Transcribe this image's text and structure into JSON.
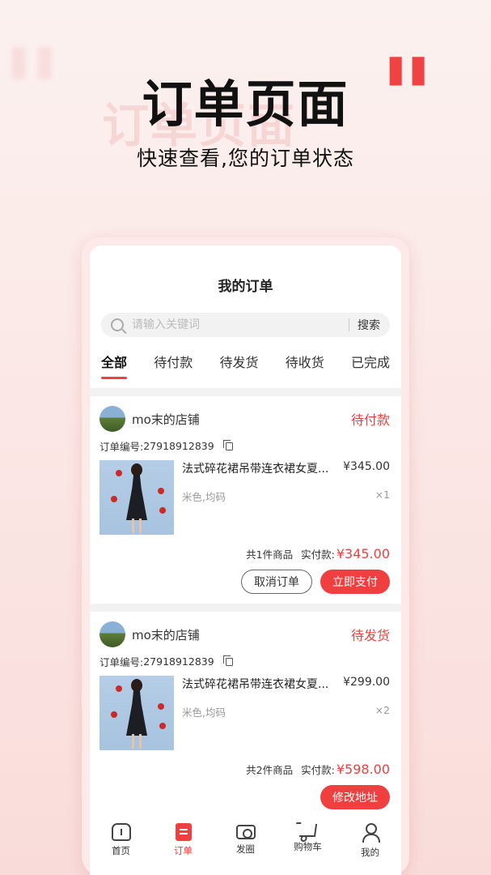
{
  "promo": {
    "title": "订单页面",
    "subtitle": "快速查看,您的订单状态"
  },
  "page": {
    "title": "我的订单"
  },
  "search": {
    "placeholder": "请输入关键词",
    "button": "搜索"
  },
  "tabs": [
    {
      "label": "全部",
      "active": true
    },
    {
      "label": "待付款",
      "active": false
    },
    {
      "label": "待发货",
      "active": false
    },
    {
      "label": "待收货",
      "active": false
    },
    {
      "label": "已完成",
      "active": false
    }
  ],
  "orders": [
    {
      "shop_name": "mo末的店铺",
      "status": "待付款",
      "order_no_label": "订单编号:",
      "order_no": "27918912839",
      "product_name": "法式碎花裙吊带连衣裙女夏...",
      "price": "¥345.00",
      "spec": "米色,均码",
      "qty": "×1",
      "count_text": "共1件商品",
      "paid_label": "实付款:",
      "paid_amount": "¥345.00",
      "buttons": [
        "取消订单",
        "立即支付"
      ]
    },
    {
      "shop_name": "mo末的店铺",
      "status": "待发货",
      "order_no_label": "订单编号:",
      "order_no": "27918912839",
      "product_name": "法式碎花裙吊带连衣裙女夏...",
      "price": "¥299.00",
      "spec": "米色,均码",
      "qty": "×2",
      "count_text": "共2件商品",
      "paid_label": "实付款:",
      "paid_amount": "¥598.00",
      "buttons": [
        "修改地址"
      ]
    }
  ],
  "nav": [
    {
      "label": "首页",
      "icon": "home-icon"
    },
    {
      "label": "订单",
      "icon": "order-icon",
      "active": true
    },
    {
      "label": "发圈",
      "icon": "camera-icon"
    },
    {
      "label": "购物车",
      "icon": "cart-icon"
    },
    {
      "label": "我的",
      "icon": "user-icon"
    }
  ],
  "colors": {
    "accent": "#ef3f3f",
    "background": "#fbe8e6"
  }
}
